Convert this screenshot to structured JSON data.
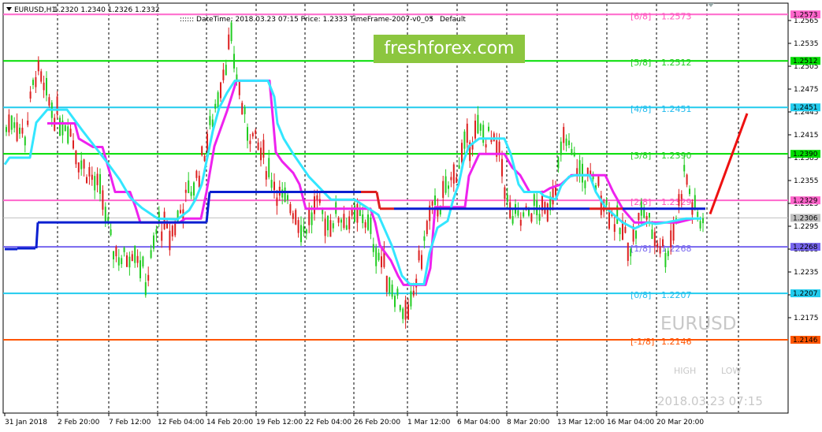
{
  "header": {
    "symbol": "EURUSD,H1",
    "ohlc": "1.2320 1.2340 1.2326 1.2332",
    "info": ":::::: DateTime: 2018.03.23 07:15    Price: 1.2333    TimeFrame-2007-v0_05",
    "default_label": "Default"
  },
  "brand": "freshforex.com",
  "watermark": {
    "symbol": "EURUSD",
    "high": "HIGH",
    "low": "LOW",
    "datetime": "2018.03.23 07:15"
  },
  "colors": {
    "candle_up": "#22cc22",
    "candle_down": "#dd2020",
    "cyan_line": "#33e6ff",
    "magenta_line": "#ee22ee",
    "blue_red_line": "#0a1fd0",
    "forecast": "#ee1111"
  },
  "chart_data": {
    "type": "candlestick",
    "ylim": [
      1.2145,
      1.258
    ],
    "y_ticks": [
      "1.2565",
      "1.2535",
      "1.2505",
      "1.2475",
      "1.2445",
      "1.2415",
      "1.2385",
      "1.2355",
      "1.2325",
      "1.2295",
      "1.2265",
      "1.2235",
      "1.2205",
      "1.2175"
    ],
    "y_tick_values": [
      1.2565,
      1.2535,
      1.2505,
      1.2475,
      1.2445,
      1.2415,
      1.2385,
      1.2355,
      1.2325,
      1.2295,
      1.2265,
      1.2235,
      1.2205,
      1.2175
    ],
    "x_ticks": [
      "31 Jan 2018",
      "2 Feb 20:00",
      "7 Feb 12:00",
      "12 Feb 04:00",
      "14 Feb 20:00",
      "19 Feb 12:00",
      "22 Feb 04:00",
      "26 Feb 20:00",
      "1 Mar 12:00",
      "6 Mar 04:00",
      "8 Mar 20:00",
      "13 Mar 12:00",
      "16 Mar 04:00",
      "20 Mar 20:00"
    ],
    "murrey_levels": [
      {
        "label": "[6/8]",
        "value": "1.2573",
        "price": 1.2573,
        "color": "#ff66cc",
        "text_color": "#ff55bb"
      },
      {
        "label": "[5/8]",
        "value": "1.2512",
        "price": 1.2512,
        "color": "#00dd00",
        "text_color": "#22cc22"
      },
      {
        "label": "[4/8]",
        "value": "1.2451",
        "price": 1.2451,
        "color": "#22ccee",
        "text_color": "#22bbee"
      },
      {
        "label": "[3/8]",
        "value": "1.2390",
        "price": 1.239,
        "color": "#00dd00",
        "text_color": "#22cc22"
      },
      {
        "label": "[2/8]",
        "value": "1.2329",
        "price": 1.2329,
        "color": "#ff66cc",
        "text_color": "#ff55bb"
      },
      {
        "label": "[1/8]",
        "value": "1.2268",
        "price": 1.2268,
        "color": "#7766ee",
        "text_color": "#7766ee"
      },
      {
        "label": "[0/8]",
        "value": "1.2207",
        "price": 1.2207,
        "color": "#22ccee",
        "text_color": "#22bbee"
      },
      {
        "label": "[-1/8]",
        "value": "1.2146",
        "price": 1.2146,
        "color": "#ff5500",
        "text_color": "#ff5500"
      }
    ],
    "current_price": {
      "value": "1.2306",
      "price": 1.2306
    },
    "red_price": {
      "value": "1.2332",
      "price": 1.2332
    },
    "forecast_line": {
      "from_price": 1.2311,
      "to_price": 1.2443
    },
    "cyan_series": [
      1.2376,
      1.2385,
      1.2385,
      1.2385,
      1.2431,
      1.2448,
      1.2448,
      1.2448,
      1.2448,
      1.2448,
      1.2448,
      1.2448,
      1.2448,
      1.2448,
      1.2448,
      1.2448,
      1.2448,
      1.2448,
      1.2448,
      1.2448,
      1.2448,
      1.2448,
      1.2448,
      1.2448,
      1.242,
      1.24,
      1.238,
      1.2356,
      1.2333,
      1.2319,
      1.2294,
      1.2273,
      1.2266,
      1.2266,
      1.2266,
      1.2266,
      1.2266,
      1.2266,
      1.2266,
      1.2266,
      1.2266,
      1.2266,
      1.2266,
      1.2266,
      1.2266,
      1.2266,
      1.2266,
      1.2266,
      1.2266,
      1.2266,
      1.2266,
      1.2266,
      1.2266,
      1.2266,
      1.2266,
      1.2266,
      1.2266,
      1.2266,
      1.2266,
      1.2266,
      1.2266,
      1.2266,
      1.2266,
      1.2266,
      1.2267,
      1.2267,
      1.2267,
      1.2267,
      1.2267,
      1.2267,
      1.2267,
      1.2267,
      1.2267,
      1.2267,
      1.2267,
      1.2267,
      1.2267,
      1.2267,
      1.2267,
      1.2267,
      1.2267,
      1.2267,
      1.2267,
      1.2267,
      1.2268,
      1.2268,
      1.227,
      1.227,
      1.228,
      1.2285,
      1.23,
      1.2304,
      1.2304,
      1.2304,
      1.2304,
      1.2311,
      1.2311,
      1.2311,
      1.2311,
      1.2316,
      1.2316,
      1.2316,
      1.2316,
      1.233,
      1.233,
      1.233,
      1.233,
      1.233,
      1.2333,
      1.2333,
      1.2345,
      1.2345,
      1.2345,
      1.2345,
      1.235,
      1.2355,
      1.236,
      1.236,
      1.2372,
      1.2377,
      1.2377,
      1.2377,
      1.2385,
      1.2393,
      1.2395,
      1.2395,
      1.2395,
      1.2397,
      1.2417,
      1.242,
      1.242,
      1.2421,
      1.2421,
      1.2421,
      1.2421,
      1.2421,
      1.2421,
      1.2421,
      1.2421,
      1.2421,
      1.2421,
      1.2421,
      1.2421,
      1.2421,
      1.2421,
      1.2421,
      1.2421,
      1.2421,
      1.2421,
      1.2421,
      1.2421,
      1.2421,
      1.2421,
      1.2421,
      1.2421,
      1.2421,
      1.2421,
      1.2421,
      1.2421,
      1.2421,
      1.2421,
      1.2421,
      1.2421,
      1.2421,
      1.2421,
      1.2421,
      1.2421,
      1.2421,
      1.2421,
      1.2421,
      1.2421,
      1.2421,
      1.2421,
      1.2421,
      1.2421,
      1.2421,
      1.2421,
      1.2421,
      1.2421,
      1.2421,
      1.2421,
      1.2421,
      1.2421,
      1.2421,
      1.2421,
      1.2421,
      1.2421,
      1.2421,
      1.2421,
      1.2421,
      1.2421,
      1.2421,
      1.2421,
      1.2421,
      1.2421,
      1.2421,
      1.2421,
      1.2421,
      1.2421,
      1.2421,
      1.2421,
      1.2421,
      1.2421,
      1.2421,
      1.2421,
      1.2421,
      1.2421,
      1.2421,
      1.2421,
      1.2421,
      1.2421,
      1.2421,
      1.2421,
      1.2421,
      1.2421,
      1.2421,
      1.2421,
      1.2421,
      1.2421,
      1.2421,
      1.2421,
      1.2421,
      1.2421,
      1.2421,
      1.2421,
      1.2421,
      1.2421,
      1.2421,
      1.2421,
      1.2421,
      1.2421,
      1.2421,
      1.2421,
      1.2421
    ],
    "cyan_points": [
      [
        1.2376,
        6
      ],
      [
        1.2385,
        12
      ],
      [
        1.2385,
        38
      ],
      [
        1.2431,
        46
      ],
      [
        1.2448,
        60
      ],
      [
        1.2448,
        85
      ],
      [
        1.242,
        105
      ],
      [
        1.24,
        120
      ],
      [
        1.238,
        135
      ],
      [
        1.2356,
        152
      ],
      [
        1.2333,
        165
      ],
      [
        1.2319,
        180
      ],
      [
        1.2305,
        200
      ],
      [
        1.2304,
        225
      ],
      [
        1.2316,
        240
      ],
      [
        1.233,
        248
      ],
      [
        1.235,
        256
      ],
      [
        1.238,
        262
      ],
      [
        1.242,
        270
      ],
      [
        1.245,
        278
      ],
      [
        1.247,
        288
      ],
      [
        1.2486,
        298
      ],
      [
        1.2486,
        340
      ],
      [
        1.2465,
        348
      ],
      [
        1.243,
        352
      ],
      [
        1.241,
        360
      ],
      [
        1.239,
        372
      ],
      [
        1.236,
        392
      ],
      [
        1.233,
        420
      ],
      [
        1.233,
        450
      ],
      [
        1.231,
        480
      ],
      [
        1.227,
        497
      ],
      [
        1.223,
        510
      ],
      [
        1.2219,
        520
      ],
      [
        1.2219,
        538
      ],
      [
        1.226,
        545
      ],
      [
        1.2293,
        555
      ],
      [
        1.2302,
        568
      ],
      [
        1.233,
        575
      ],
      [
        1.235,
        582
      ],
      [
        1.238,
        588
      ],
      [
        1.24,
        595
      ],
      [
        1.241,
        608
      ],
      [
        1.241,
        640
      ],
      [
        1.239,
        648
      ],
      [
        1.235,
        658
      ],
      [
        1.234,
        665
      ],
      [
        1.234,
        685
      ],
      [
        1.2335,
        690
      ],
      [
        1.233,
        705
      ],
      [
        1.2348,
        712
      ],
      [
        1.236,
        722
      ],
      [
        1.2362,
        730
      ],
      [
        1.2362,
        748
      ],
      [
        1.234,
        756
      ],
      [
        1.232,
        768
      ],
      [
        1.23,
        790
      ],
      [
        1.2292,
        805
      ],
      [
        1.23,
        822
      ],
      [
        1.2298,
        832
      ],
      [
        1.23,
        845
      ],
      [
        1.2305,
        870
      ],
      [
        1.2305,
        890
      ]
    ],
    "magenta_points": [
      [
        1.243,
        60
      ],
      [
        1.243,
        95
      ],
      [
        1.241,
        100
      ],
      [
        1.2399,
        118
      ],
      [
        1.2399,
        130
      ],
      [
        1.237,
        138
      ],
      [
        1.234,
        146
      ],
      [
        1.234,
        165
      ],
      [
        1.232,
        172
      ],
      [
        1.23,
        178
      ],
      [
        1.23,
        228
      ],
      [
        1.2305,
        235
      ],
      [
        1.2305,
        255
      ],
      [
        1.234,
        262
      ],
      [
        1.24,
        272
      ],
      [
        1.2446,
        288
      ],
      [
        1.2486,
        300
      ],
      [
        1.2486,
        342
      ],
      [
        1.244,
        346
      ],
      [
        1.2392,
        350
      ],
      [
        1.238,
        358
      ],
      [
        1.2365,
        372
      ],
      [
        1.235,
        380
      ],
      [
        1.2318,
        388
      ],
      [
        1.2318,
        470
      ],
      [
        1.23,
        476
      ],
      [
        1.227,
        482
      ],
      [
        1.225,
        496
      ],
      [
        1.223,
        505
      ],
      [
        1.2218,
        512
      ],
      [
        1.2218,
        540
      ],
      [
        1.224,
        546
      ],
      [
        1.232,
        552
      ],
      [
        1.232,
        590
      ],
      [
        1.2361,
        595
      ],
      [
        1.239,
        608
      ],
      [
        1.239,
        635
      ],
      [
        1.239,
        640
      ],
      [
        1.2372,
        650
      ],
      [
        1.2362,
        660
      ],
      [
        1.234,
        672
      ],
      [
        1.234,
        690
      ],
      [
        1.2345,
        698
      ],
      [
        1.235,
        712
      ],
      [
        1.2362,
        725
      ],
      [
        1.2362,
        768
      ],
      [
        1.234,
        778
      ],
      [
        1.2318,
        790
      ],
      [
        1.23,
        805
      ],
      [
        1.23,
        822
      ],
      [
        1.23,
        840
      ],
      [
        1.23,
        860
      ],
      [
        1.2305,
        880
      ]
    ],
    "blue_segments": [
      {
        "price": 1.2265,
        "x1": 6,
        "x2": 22
      },
      {
        "price": 1.2266,
        "x1": 22,
        "x2": 45
      },
      {
        "price": 1.23,
        "x1": 48,
        "x2": 262
      },
      {
        "price": 1.234,
        "x1": 266,
        "x2": 458
      },
      {
        "price": 1.2318,
        "x1": 500,
        "x2": 748
      },
      {
        "price": 1.2318,
        "x1": 790,
        "x2": 895
      }
    ],
    "red_segments": [
      {
        "price": 1.234,
        "x1": 458,
        "x2": 478
      },
      {
        "price": 1.2318,
        "x1": 482,
        "x2": 500
      },
      {
        "price": 1.2318,
        "x1": 748,
        "x2": 790
      }
    ]
  }
}
